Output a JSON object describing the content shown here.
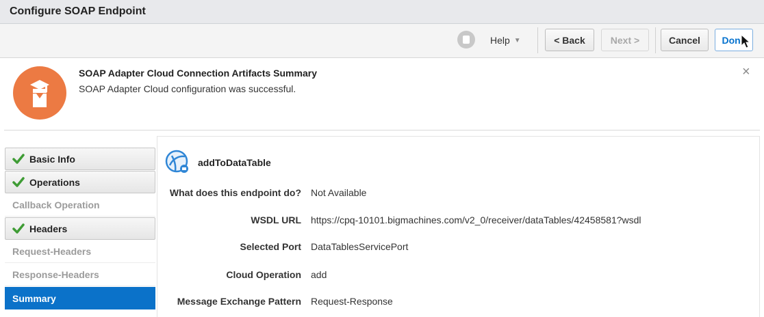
{
  "window": {
    "title": "Configure SOAP Endpoint"
  },
  "toolbar": {
    "help_label": "Help",
    "back_label": "< Back",
    "next_label": "Next >",
    "cancel_label": "Cancel",
    "done_label": "Done"
  },
  "banner": {
    "title": "SOAP Adapter Cloud Connection Artifacts Summary",
    "message": "SOAP Adapter Cloud configuration was successful.",
    "close_label": "×"
  },
  "nav": {
    "items": [
      {
        "label": "Basic Info",
        "state": "done"
      },
      {
        "label": "Operations",
        "state": "done"
      },
      {
        "label": "Callback Operation",
        "state": "pending"
      },
      {
        "label": "Headers",
        "state": "done"
      },
      {
        "label": "Request-Headers",
        "state": "pending"
      },
      {
        "label": "Response-Headers",
        "state": "pending"
      },
      {
        "label": "Summary",
        "state": "active"
      }
    ]
  },
  "summary": {
    "endpoint_name": "addToDataTable",
    "fields": [
      {
        "label": "What does this endpoint do?",
        "value": "Not Available"
      },
      {
        "label": "WSDL URL",
        "value": "https://cpq-10101.bigmachines.com/v2_0/receiver/dataTables/42458581?wsdl"
      },
      {
        "label": "Selected Port",
        "value": "DataTablesServicePort"
      },
      {
        "label": "Cloud Operation",
        "value": "add"
      },
      {
        "label": "Message Exchange Pattern",
        "value": "Request-Response"
      }
    ]
  },
  "colors": {
    "accent": "#0b72c9",
    "banner_icon": "#ec7a43",
    "check": "#3f9c35"
  },
  "icons": {
    "banner": "adapter-artifact-icon",
    "endpoint": "soap-endpoint-globe-icon",
    "status": "checkmark-icon"
  }
}
